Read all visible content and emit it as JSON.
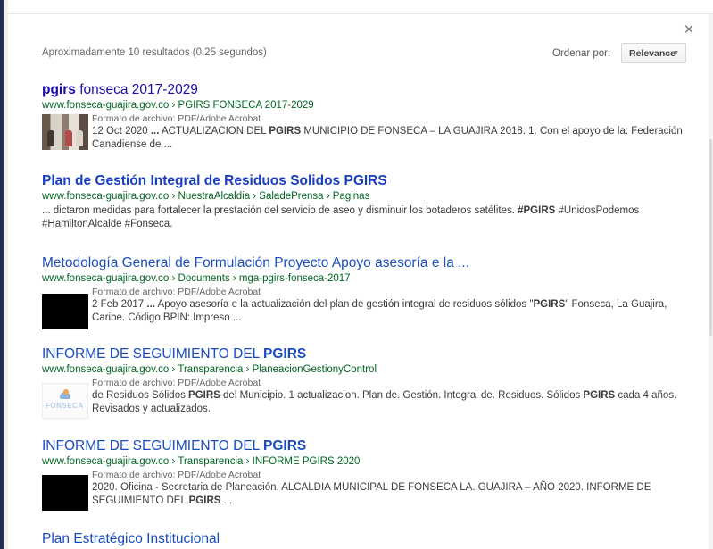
{
  "header": {
    "result_stats": "Aproximadamente 10 resultados (0.25 segundos)",
    "sort_label": "Ordenar por:",
    "sort_value": "Relevance",
    "close_icon": "close-icon",
    "close_glyph": "×"
  },
  "results": [
    {
      "title_bold": "pgirs",
      "title_rest": " fonseca 2017-2029",
      "url": "www.fonseca-guajira.gov.co › PGIRS FONSECA 2017-2029",
      "meta": "Formato de archivo: PDF/Adobe Acrobat",
      "snippet_a": "12 Oct 2020 ",
      "snippet_b": "...",
      "snippet_c": " ACTUALIZACION DEL ",
      "snippet_d": "PGIRS",
      "snippet_e": " MUNICIPIO DE FONSECA – LA GUAJIRA 2018. 1. Con el apoyo de la: Federación Canadiense de ...",
      "thumbnail": "photo"
    },
    {
      "title": "Plan de Gestión Integral de Residuos Solidos PGIRS",
      "url": "www.fonseca-guajira.gov.co › NuestraAlcaldia › SaladePrensa › Paginas",
      "snippet_a": "... dictaron medidas para fortalecer la prestación del servicio de aseo y disminuir los botaderos satélites. ",
      "snippet_b": "#PGIRS",
      "snippet_c": " #UnidosPodemos #HamiltonAlcalde #Fonseca."
    },
    {
      "title": "Metodología General de Formulación Proyecto Apoyo asesoría e la ...",
      "url": "www.fonseca-guajira.gov.co › Documents › mga-pgirs-fonseca-2017",
      "meta": "Formato de archivo: PDF/Adobe Acrobat",
      "snippet_a": "2 Feb 2017 ",
      "snippet_b": "...",
      "snippet_c": " Apoyo asesoría e la actualización del plan de gestión integral de residuos sólidos \"",
      "snippet_d": "PGIRS",
      "snippet_e": "\" Fonseca, La Guajira, Caribe. Código BPIN: Impreso ...",
      "thumbnail": "black"
    },
    {
      "title_rest": "INFORME DE SEGUIMIENTO DEL ",
      "title_bold": "PGIRS",
      "url": "www.fonseca-guajira.gov.co › Transparencia › PlaneacionGestionyControl",
      "meta": "Formato de archivo: PDF/Adobe Acrobat",
      "snippet_a": "de Residuos Sólidos ",
      "snippet_b": "PGIRS",
      "snippet_c": " del Municipio. 1 actualizacion. Plan de. Gestión. Integral de. Residuos. Sólidos ",
      "snippet_d": "PGIRS",
      "snippet_e": " cada 4 años. Revisados y actualizados.",
      "thumbnail": "logo",
      "logo_text": "FONSECA"
    },
    {
      "title_rest": "INFORME DE SEGUIMIENTO DEL ",
      "title_bold": "PGIRS",
      "url": "www.fonseca-guajira.gov.co › Transparencia › INFORME PGIRS 2020",
      "meta": "Formato de archivo: PDF/Adobe Acrobat",
      "snippet_a": "2020. Oficina - Secretaria de Planeación. ALCALDIA MUNICIPAL DE FONSECA LA. GUAJIRA – AÑO 2020. INFORME DE SEGUIMIENTO DEL ",
      "snippet_b": "PGIRS",
      "snippet_c": " ...",
      "thumbnail": "black"
    },
    {
      "title": "Plan Estratégico Institucional"
    }
  ],
  "colors": {
    "link": "#1a0dab",
    "url_green": "#006621",
    "snippet": "#444444"
  }
}
